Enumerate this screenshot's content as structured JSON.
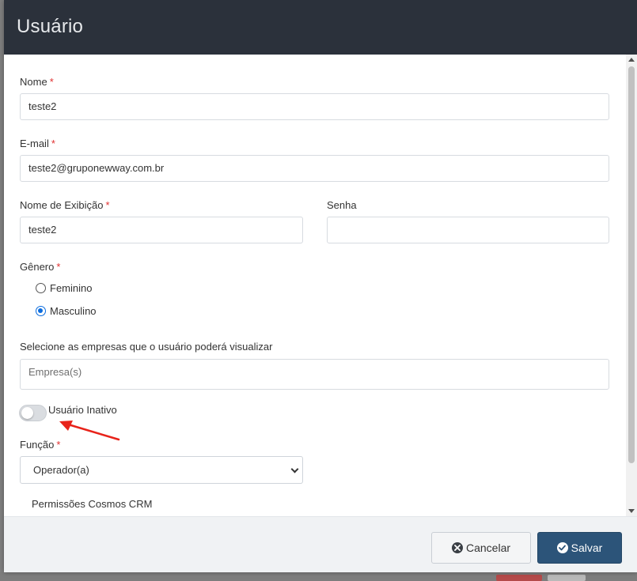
{
  "modal": {
    "title": "Usuário"
  },
  "form": {
    "nome": {
      "label": "Nome",
      "required": "*",
      "value": "teste2"
    },
    "email": {
      "label": "E-mail",
      "required": "*",
      "value": "teste2@gruponewway.com.br"
    },
    "nome_exibicao": {
      "label": "Nome de Exibição",
      "required": "*",
      "value": "teste2"
    },
    "senha": {
      "label": "Senha",
      "value": ""
    },
    "genero": {
      "label": "Gênero",
      "required": "*",
      "options": [
        "Feminino",
        "Masculino"
      ],
      "selected": "Masculino"
    },
    "empresas": {
      "label": "Selecione as empresas que o usuário poderá visualizar",
      "placeholder": "Empresa(s)"
    },
    "inativo": {
      "label": "Usuário Inativo",
      "on": false
    },
    "funcao": {
      "label": "Função",
      "required": "*",
      "value": "Operador(a)"
    },
    "permissoes": {
      "label": "Permissões Cosmos CRM"
    }
  },
  "footer": {
    "cancel_label": "Cancelar",
    "save_label": "Salvar"
  },
  "colors": {
    "header_bg": "#2b313b",
    "save_bg": "#2c5479",
    "required": "#e03131",
    "radio_accent": "#0b6cde",
    "annotation_arrow": "#e8231a"
  },
  "icons": {
    "cancel": "times-circle-icon",
    "save": "check-circle-icon"
  }
}
